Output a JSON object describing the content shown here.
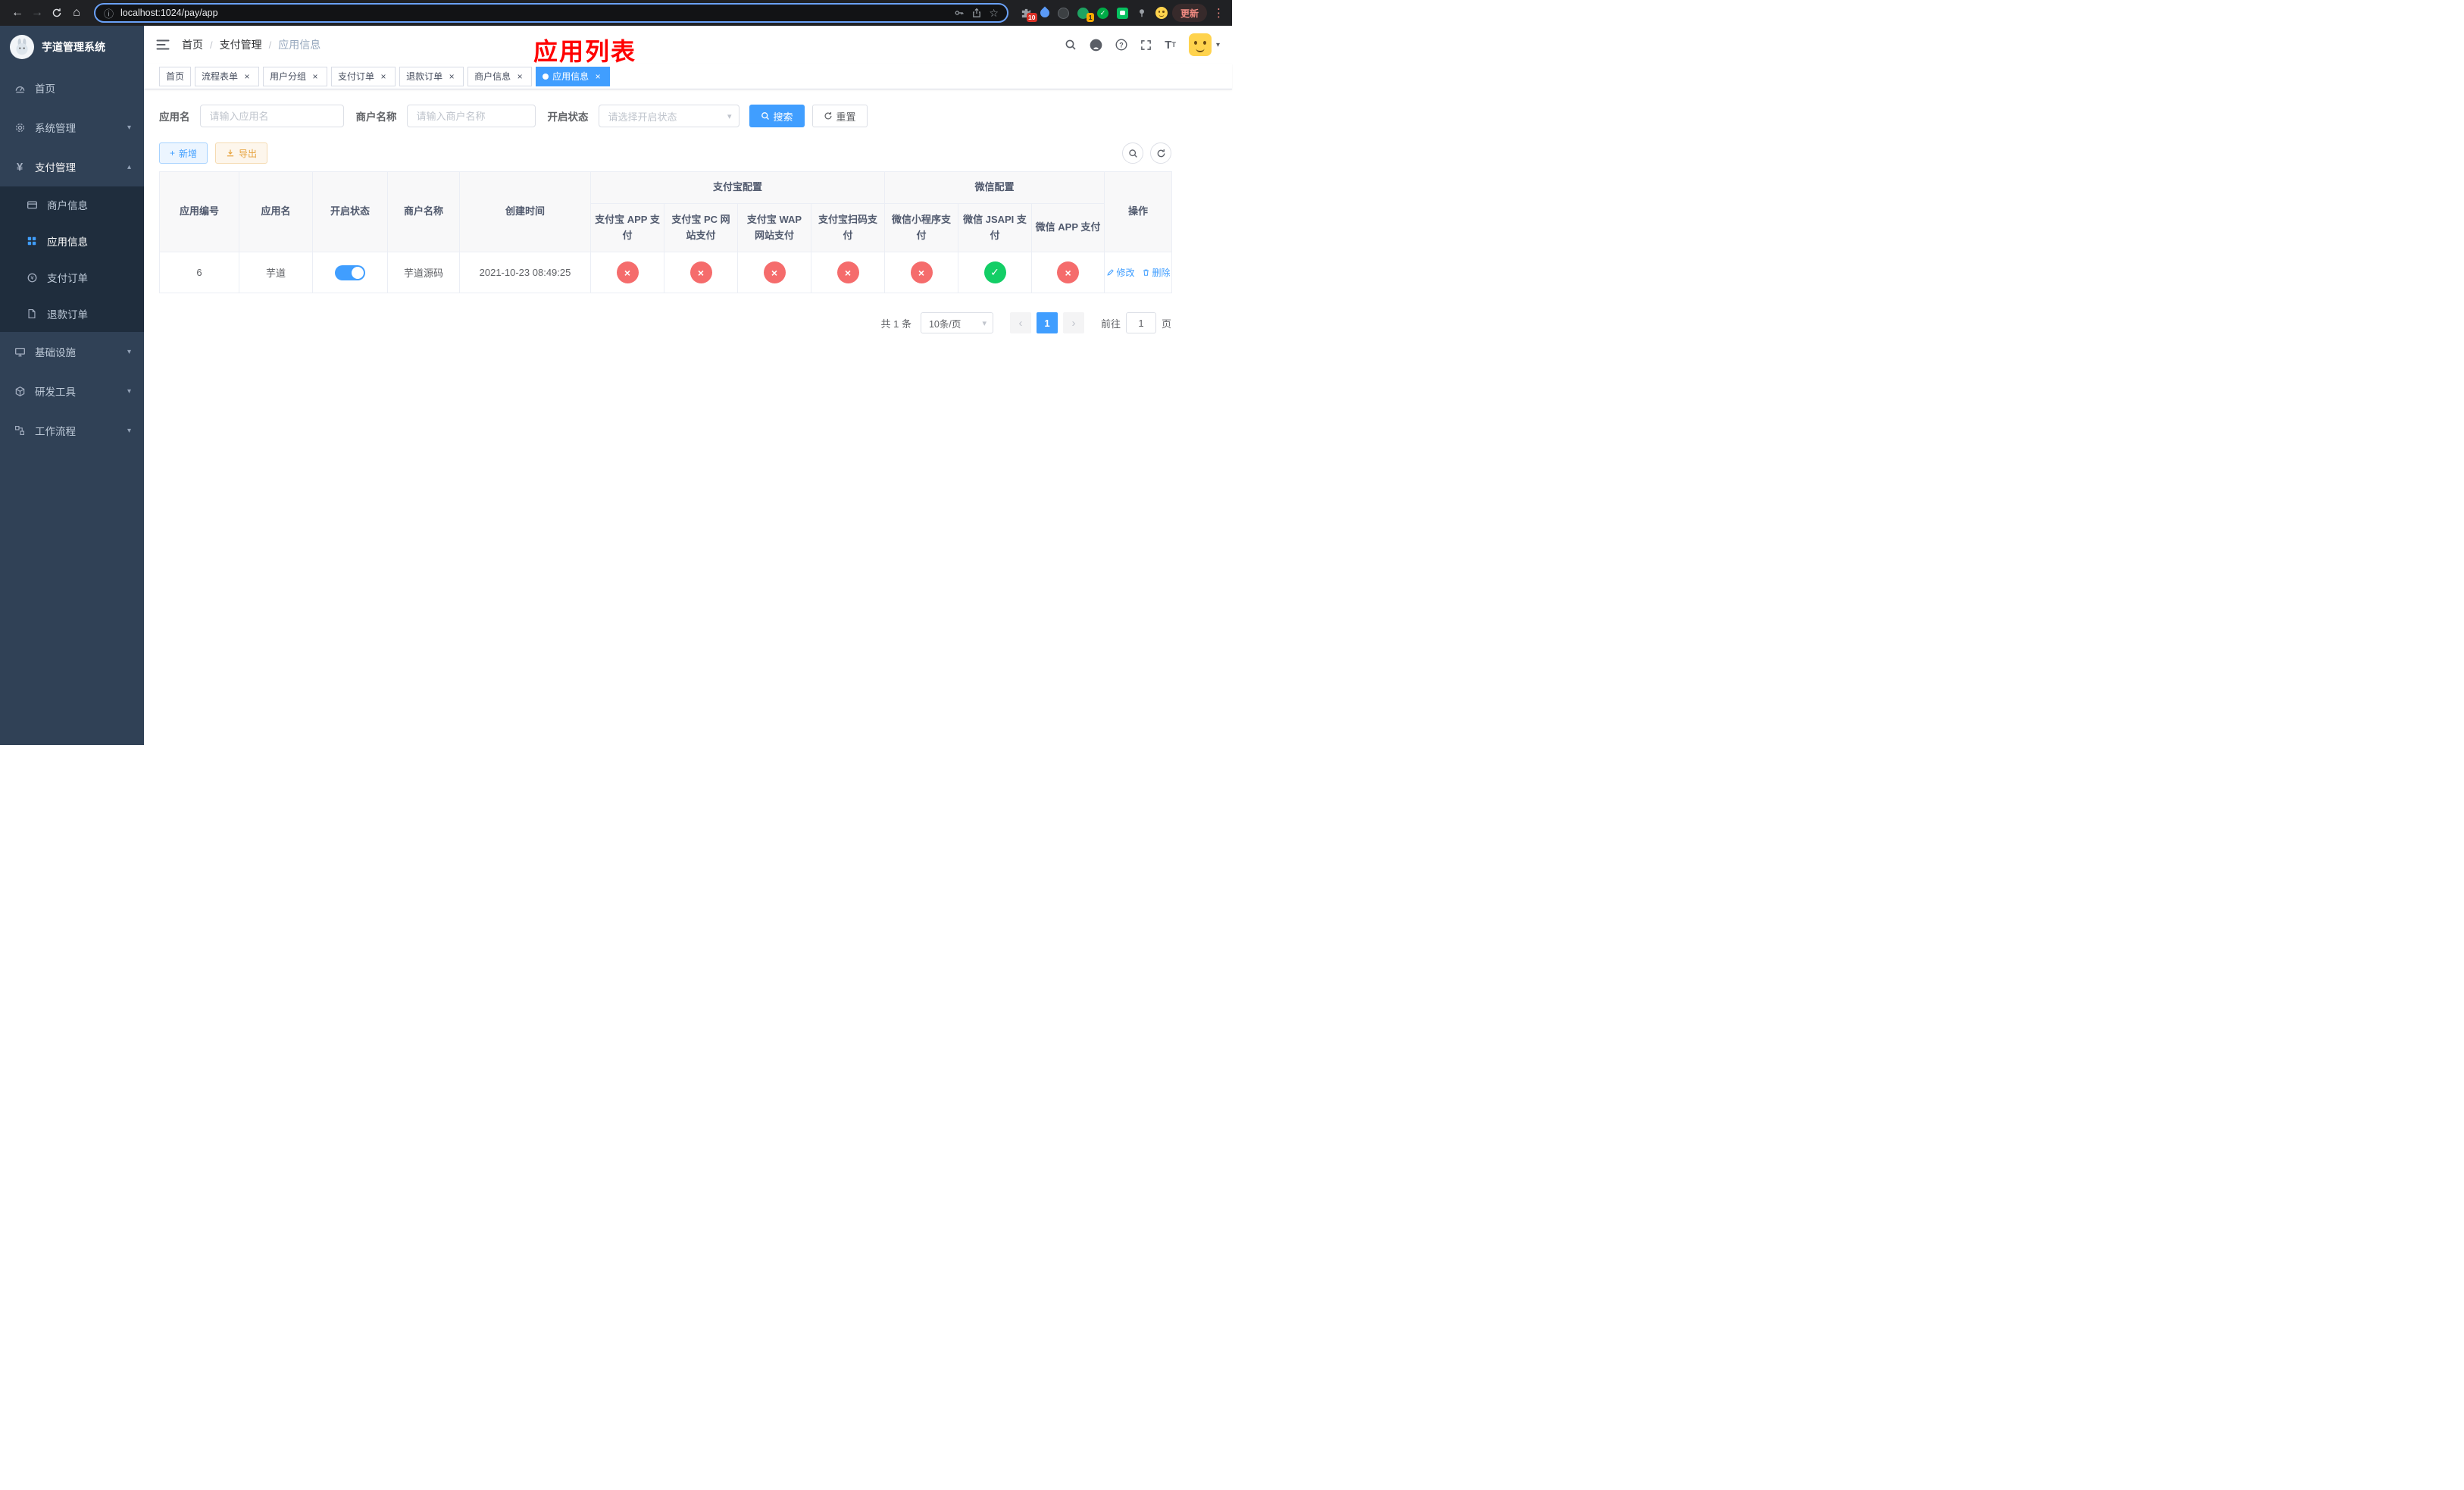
{
  "colors": {
    "accent": "#409eff",
    "success": "#13ce66",
    "danger": "#f56c6c",
    "sidebar_bg": "#304156"
  },
  "browser": {
    "url": "localhost:1024/pay/app",
    "update_label": "更新",
    "extensions_badge": "10",
    "app_badge": "1"
  },
  "sidebar": {
    "title": "芋道管理系统",
    "items": [
      {
        "label": "首页"
      },
      {
        "label": "系统管理"
      },
      {
        "label": "支付管理"
      },
      {
        "label": "商户信息"
      },
      {
        "label": "应用信息"
      },
      {
        "label": "支付订单"
      },
      {
        "label": "退款订单"
      },
      {
        "label": "基础设施"
      },
      {
        "label": "研发工具"
      },
      {
        "label": "工作流程"
      }
    ]
  },
  "header": {
    "breadcrumb": [
      "首页",
      "支付管理",
      "应用信息"
    ],
    "annotation": "应用列表"
  },
  "tabs": [
    {
      "label": "首页",
      "closable": false,
      "active": false
    },
    {
      "label": "流程表单",
      "closable": true,
      "active": false
    },
    {
      "label": "用户分组",
      "closable": true,
      "active": false
    },
    {
      "label": "支付订单",
      "closable": true,
      "active": false
    },
    {
      "label": "退款订单",
      "closable": true,
      "active": false
    },
    {
      "label": "商户信息",
      "closable": true,
      "active": false
    },
    {
      "label": "应用信息",
      "closable": true,
      "active": true
    }
  ],
  "filters": {
    "app_name_label": "应用名",
    "app_name_placeholder": "请输入应用名",
    "merchant_label": "商户名称",
    "merchant_placeholder": "请输入商户名称",
    "status_label": "开启状态",
    "status_placeholder": "请选择开启状态",
    "search_label": "搜索",
    "reset_label": "重置"
  },
  "toolbar": {
    "add_label": "新增",
    "export_label": "导出"
  },
  "table": {
    "groups": {
      "alipay": "支付宝配置",
      "wechat": "微信配置"
    },
    "columns": {
      "id": "应用编号",
      "name": "应用名",
      "status": "开启状态",
      "merchant": "商户名称",
      "created": "创建时间",
      "alipay_app": "支付宝 APP 支付",
      "alipay_pc": "支付宝 PC 网站支付",
      "alipay_wap": "支付宝 WAP 网站支付",
      "alipay_qr": "支付宝扫码支付",
      "wx_mini": "微信小程序支付",
      "wx_jsapi": "微信 JSAPI 支付",
      "wx_app": "微信 APP 支付",
      "actions": "操作"
    },
    "rows": [
      {
        "id": "6",
        "name": "芋道",
        "status_on": true,
        "merchant": "芋道源码",
        "created": "2021-10-23 08:49:25",
        "configs": [
          false,
          false,
          false,
          false,
          false,
          true,
          false
        ],
        "edit_label": "修改",
        "delete_label": "删除"
      }
    ]
  },
  "pagination": {
    "total": "共 1 条",
    "page_size": "10条/页",
    "page": "1",
    "goto_label": "前往",
    "goto_value": "1",
    "page_unit": "页"
  }
}
